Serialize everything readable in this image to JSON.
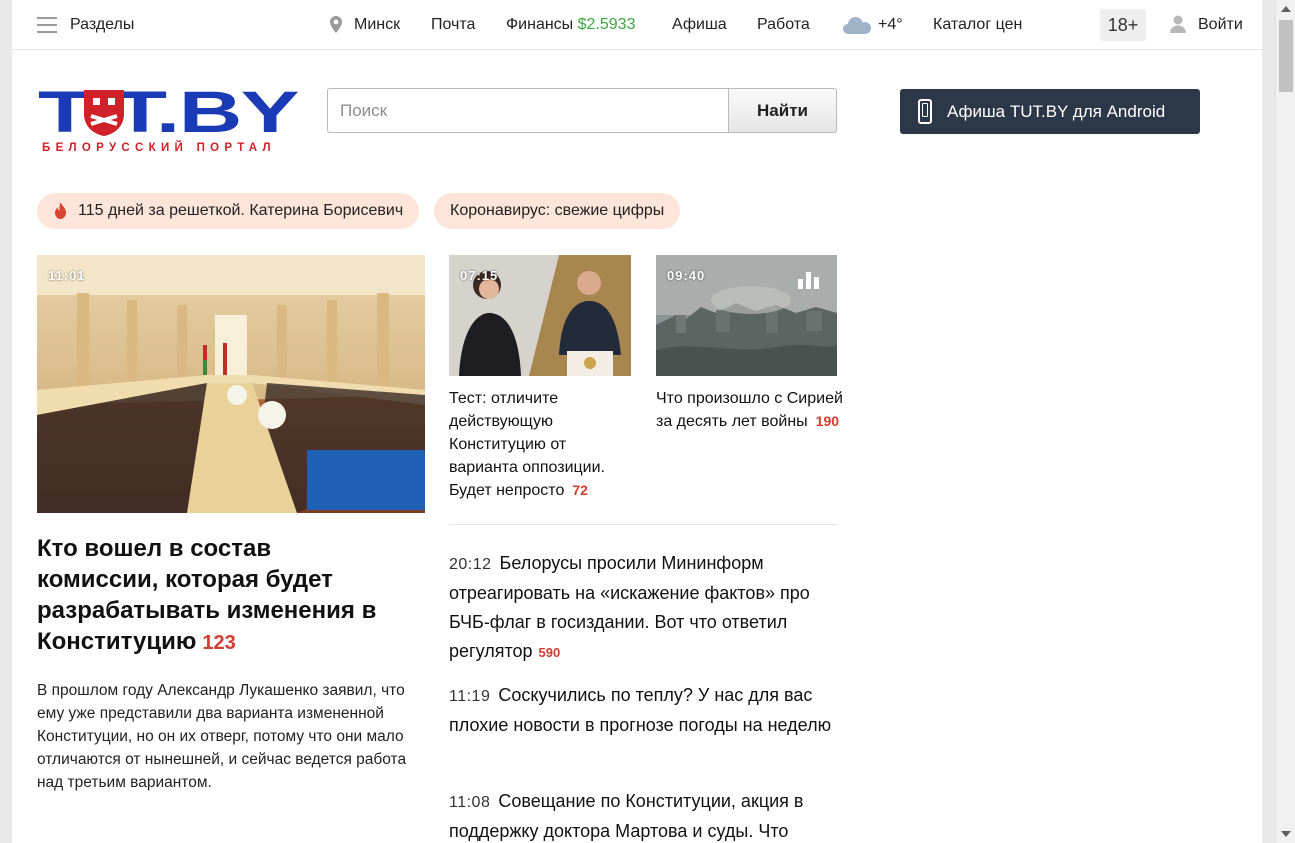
{
  "topbar": {
    "sections_label": "Разделы",
    "city": "Минск",
    "mail": "Почта",
    "finance_label": "Финансы",
    "finance_value": "$2.5933",
    "afisha": "Афиша",
    "jobs": "Работа",
    "weather": "+4°",
    "catalog": "Каталог цен",
    "age_badge": "18+",
    "login": "Войти"
  },
  "header": {
    "logo_text": "TUT.BY",
    "logo_subtitle": "БЕЛОРУССКИЙ ПОРТАЛ",
    "search_placeholder": "Поиск",
    "search_button": "Найти",
    "android_promo": "Афиша TUT.BY для Android"
  },
  "tags": [
    {
      "label": "115 дней за решеткой. Катерина Борисевич",
      "icon": "flame-icon"
    },
    {
      "label": "Коронавирус: свежие цифры"
    }
  ],
  "main_story": {
    "time": "11:01",
    "title": "Кто вошел в состав комиссии, которая будет разрабатывать изменения в Конституцию",
    "comments": "123",
    "lead": "В прошлом году Александр Лукашенко заявил, что ему уже представили два варианта измененной Конституции, но он их отверг, потому что они мало отличаются от нынешней, и сейчас ведется работа над третьим вариантом."
  },
  "cards": [
    {
      "time": "07:15",
      "title": "Тест: отличите действующую Конституцию от варианта оппозиции. Будет непросто",
      "comments": "72"
    },
    {
      "time": "09:40",
      "title": "Что произошло с Сирией за десять лет войны",
      "comments": "190",
      "icon": "stats-icon"
    }
  ],
  "news": [
    {
      "time": "20:12",
      "title": "Белорусы просили Мининформ отреагировать на «искажение фактов» про БЧБ-флаг в госиздании. Вот что ответил регулятор",
      "comments": "590"
    },
    {
      "time": "11:19",
      "title": "Соскучились по теплу? У нас для вас плохие новости в прогнозе погоды на неделю"
    },
    {
      "time": "11:08",
      "title": "Совещание по Конституции, акция в поддержку доктора Мартова и суды. Что"
    }
  ],
  "colors": {
    "brand_blue": "#1a3bb5",
    "brand_red": "#d0212a",
    "comment_red": "#d23c31",
    "finance_green": "#3ea63f",
    "tag_bg": "#fde5d9",
    "android_bg": "#2c3848"
  }
}
